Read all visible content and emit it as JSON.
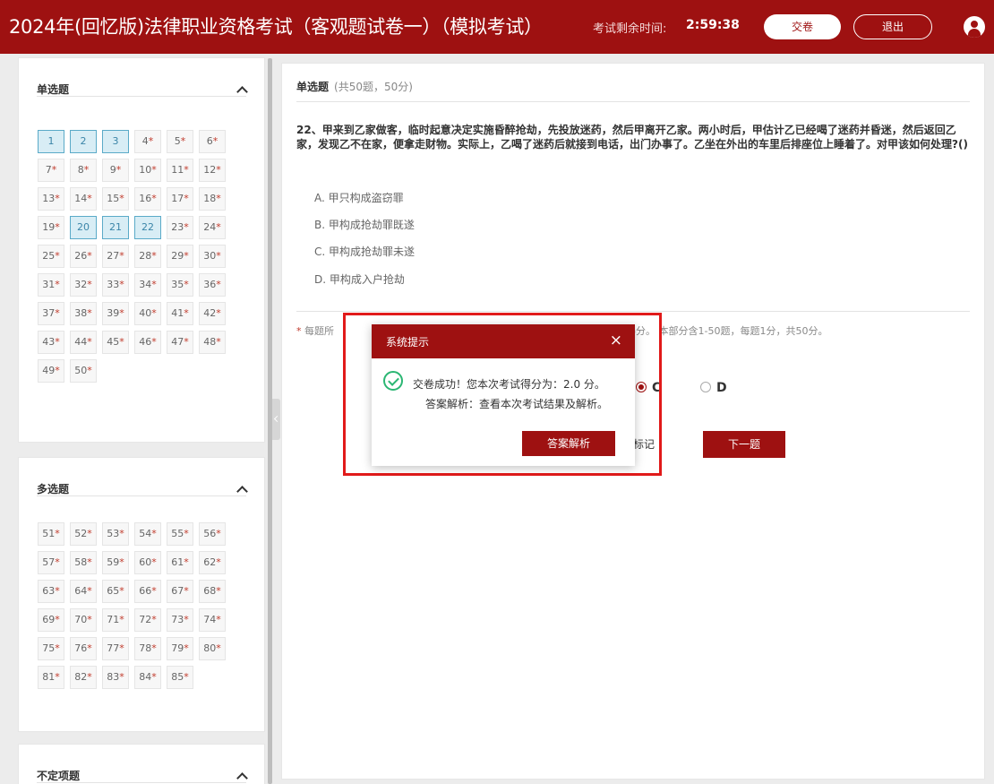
{
  "header": {
    "title": "2024年(回忆版)法律职业资格考试（客观题试卷一）（模拟考试）",
    "timer_label": "考试剩余时间:",
    "timer_value": "2:59:38",
    "submit_label": "交卷",
    "exit_label": "退出"
  },
  "sidebar": {
    "sections": [
      {
        "title": "单选题",
        "questions": [
          {
            "n": "1",
            "answered": true
          },
          {
            "n": "2",
            "answered": true
          },
          {
            "n": "3",
            "answered": true
          },
          {
            "n": "4",
            "answered": false
          },
          {
            "n": "5",
            "answered": false
          },
          {
            "n": "6",
            "answered": false
          },
          {
            "n": "7",
            "answered": false
          },
          {
            "n": "8",
            "answered": false
          },
          {
            "n": "9",
            "answered": false
          },
          {
            "n": "10",
            "answered": false
          },
          {
            "n": "11",
            "answered": false
          },
          {
            "n": "12",
            "answered": false
          },
          {
            "n": "13",
            "answered": false
          },
          {
            "n": "14",
            "answered": false
          },
          {
            "n": "15",
            "answered": false
          },
          {
            "n": "16",
            "answered": false
          },
          {
            "n": "17",
            "answered": false
          },
          {
            "n": "18",
            "answered": false
          },
          {
            "n": "19",
            "answered": false
          },
          {
            "n": "20",
            "answered": true
          },
          {
            "n": "21",
            "answered": true
          },
          {
            "n": "22",
            "answered": true
          },
          {
            "n": "23",
            "answered": false
          },
          {
            "n": "24",
            "answered": false
          },
          {
            "n": "25",
            "answered": false
          },
          {
            "n": "26",
            "answered": false
          },
          {
            "n": "27",
            "answered": false
          },
          {
            "n": "28",
            "answered": false
          },
          {
            "n": "29",
            "answered": false
          },
          {
            "n": "30",
            "answered": false
          },
          {
            "n": "31",
            "answered": false
          },
          {
            "n": "32",
            "answered": false
          },
          {
            "n": "33",
            "answered": false
          },
          {
            "n": "34",
            "answered": false
          },
          {
            "n": "35",
            "answered": false
          },
          {
            "n": "36",
            "answered": false
          },
          {
            "n": "37",
            "answered": false
          },
          {
            "n": "38",
            "answered": false
          },
          {
            "n": "39",
            "answered": false
          },
          {
            "n": "40",
            "answered": false
          },
          {
            "n": "41",
            "answered": false
          },
          {
            "n": "42",
            "answered": false
          },
          {
            "n": "43",
            "answered": false
          },
          {
            "n": "44",
            "answered": false
          },
          {
            "n": "45",
            "answered": false
          },
          {
            "n": "46",
            "answered": false
          },
          {
            "n": "47",
            "answered": false
          },
          {
            "n": "48",
            "answered": false
          },
          {
            "n": "49",
            "answered": false
          },
          {
            "n": "50",
            "answered": false
          }
        ]
      },
      {
        "title": "多选题",
        "questions": [
          {
            "n": "51",
            "answered": false
          },
          {
            "n": "52",
            "answered": false
          },
          {
            "n": "53",
            "answered": false
          },
          {
            "n": "54",
            "answered": false
          },
          {
            "n": "55",
            "answered": false
          },
          {
            "n": "56",
            "answered": false
          },
          {
            "n": "57",
            "answered": false
          },
          {
            "n": "58",
            "answered": false
          },
          {
            "n": "59",
            "answered": false
          },
          {
            "n": "60",
            "answered": false
          },
          {
            "n": "61",
            "answered": false
          },
          {
            "n": "62",
            "answered": false
          },
          {
            "n": "63",
            "answered": false
          },
          {
            "n": "64",
            "answered": false
          },
          {
            "n": "65",
            "answered": false
          },
          {
            "n": "66",
            "answered": false
          },
          {
            "n": "67",
            "answered": false
          },
          {
            "n": "68",
            "answered": false
          },
          {
            "n": "69",
            "answered": false
          },
          {
            "n": "70",
            "answered": false
          },
          {
            "n": "71",
            "answered": false
          },
          {
            "n": "72",
            "answered": false
          },
          {
            "n": "73",
            "answered": false
          },
          {
            "n": "74",
            "answered": false
          },
          {
            "n": "75",
            "answered": false
          },
          {
            "n": "76",
            "answered": false
          },
          {
            "n": "77",
            "answered": false
          },
          {
            "n": "78",
            "answered": false
          },
          {
            "n": "79",
            "answered": false
          },
          {
            "n": "80",
            "answered": false
          },
          {
            "n": "81",
            "answered": false
          },
          {
            "n": "82",
            "answered": false
          },
          {
            "n": "83",
            "answered": false
          },
          {
            "n": "84",
            "answered": false
          },
          {
            "n": "85",
            "answered": false
          }
        ]
      },
      {
        "title": "不定项题",
        "questions": []
      }
    ]
  },
  "main": {
    "type_title": "单选题",
    "type_sub": "(共50题，50分)",
    "question": "22、甲来到乙家做客，临时起意决定实施昏醉抢劫，先投放迷药，然后甲离开乙家。两小时后，甲估计乙已经喝了迷药并昏迷，然后返回乙家，发现乙不在家，便拿走财物。实际上，乙喝了迷药后就接到电话，出门办事了。乙坐在外出的车里后排座位上睡着了。对甲该如何处理?()",
    "options": [
      "A. 甲只构成盗窃罪",
      "B. 甲构成抢劫罪既遂",
      "C. 甲构成抢劫罪未遂",
      "D. 甲构成入户抢劫"
    ],
    "note_star": "*",
    "note_left": "每题所",
    "note_mid": "得分。",
    "note_right": "本部分含1-50题，每题1分，共50分。",
    "answer_c": "C",
    "answer_d": "D",
    "mark_label": "标记",
    "next_label": "下一题"
  },
  "dialog": {
    "title": "系统提示",
    "close": "×",
    "msg1": "交卷成功！您本次考试得分为：2.0 分。",
    "msg2": "答案解析：查看本次考试结果及解析。",
    "button": "答案解析"
  },
  "colors": {
    "brand": "#9e1111",
    "answered_bg": "#d8edf5",
    "answered_border": "#5aaac8",
    "success": "#2bb673",
    "highlight": "#e11a1a"
  }
}
